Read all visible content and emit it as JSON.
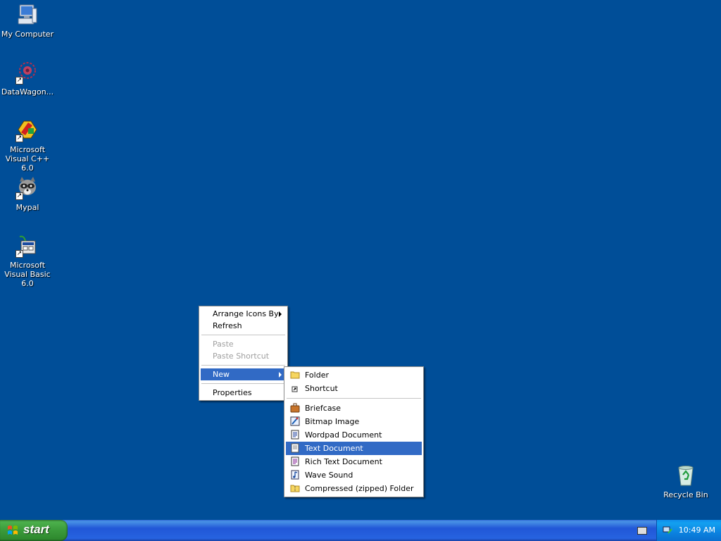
{
  "desktop": {
    "background_color": "#004e98",
    "icons": [
      {
        "label": "My Computer",
        "icon": "computer-icon"
      },
      {
        "label": "DataWagon...",
        "icon": "datawagon-icon"
      },
      {
        "label": "Microsoft Visual C++ 6.0",
        "icon": "visual-cpp-icon"
      },
      {
        "label": "Mypal",
        "icon": "mypal-raccoon-icon"
      },
      {
        "label": "Microsoft Visual Basic 6.0",
        "icon": "visual-basic-icon"
      },
      {
        "label": "Recycle Bin",
        "icon": "recycle-bin-icon"
      }
    ]
  },
  "context_menu": {
    "items": [
      {
        "label": "Arrange Icons By",
        "submenu": true
      },
      {
        "label": "Refresh"
      },
      {
        "label": "Paste",
        "disabled": true
      },
      {
        "label": "Paste Shortcut",
        "disabled": true
      },
      {
        "label": "New",
        "submenu": true,
        "highlighted": true
      },
      {
        "label": "Properties"
      }
    ]
  },
  "new_submenu": {
    "items": [
      {
        "label": "Folder",
        "icon": "folder-icon"
      },
      {
        "label": "Shortcut",
        "icon": "shortcut-icon"
      },
      {
        "label": "Briefcase",
        "icon": "briefcase-icon"
      },
      {
        "label": "Bitmap Image",
        "icon": "bitmap-icon"
      },
      {
        "label": "Wordpad Document",
        "icon": "wordpad-icon"
      },
      {
        "label": "Text Document",
        "icon": "text-document-icon",
        "highlighted": true
      },
      {
        "label": "Rich Text Document",
        "icon": "rich-text-icon"
      },
      {
        "label": "Wave Sound",
        "icon": "wave-sound-icon"
      },
      {
        "label": "Compressed (zipped) Folder",
        "icon": "zip-folder-icon"
      }
    ]
  },
  "taskbar": {
    "start_label": "start",
    "clock": "10:49 AM"
  },
  "colors": {
    "highlight": "#316ac5",
    "start_green": "#3a9a3a",
    "taskbar_blue": "#2157d7"
  }
}
